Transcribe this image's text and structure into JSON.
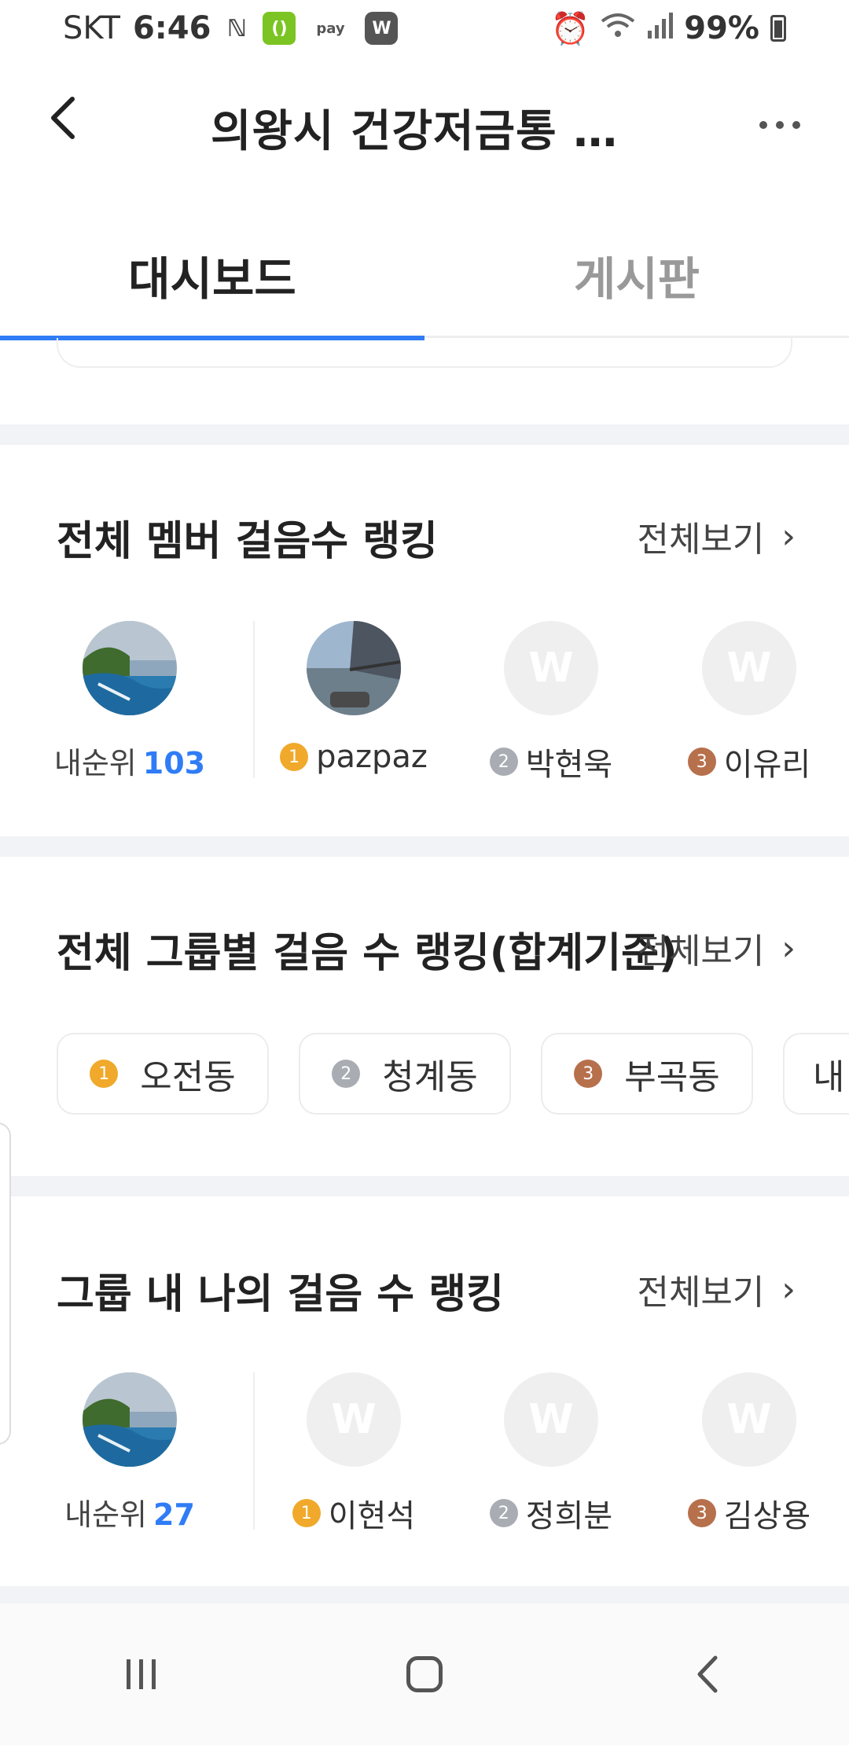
{
  "status_bar": {
    "carrier": "SKT",
    "time": "6:46",
    "app_icons": [
      "nfc-icon",
      "opinion-icon",
      "pay-icon",
      "w-app-icon"
    ],
    "pay_label": "pay",
    "battery": "99%"
  },
  "header": {
    "title": "의왕시 건강저금통 …",
    "back_icon": "back-arrow-icon",
    "more_icon": "more-icon"
  },
  "tabs": [
    {
      "label": "대시보드",
      "active": true
    },
    {
      "label": "게시판",
      "active": false
    }
  ],
  "member_ranking": {
    "title": "전체 멤버 걸음수 랭킹",
    "see_all": "전체보기",
    "my_rank_label": "내순위",
    "my_rank_value": "103",
    "members": [
      {
        "rank": "1",
        "name": "pazpaz"
      },
      {
        "rank": "2",
        "name": "박현욱"
      },
      {
        "rank": "3",
        "name": "이유리"
      }
    ]
  },
  "group_ranking": {
    "title": "전체 그룹별 걸음 수 랭킹(합계기준)",
    "see_all": "전체보기",
    "groups": [
      {
        "rank": "1",
        "name": "오전동"
      },
      {
        "rank": "2",
        "name": "청계동"
      },
      {
        "rank": "3",
        "name": "부곡동"
      },
      {
        "rank": "",
        "name": "내"
      }
    ]
  },
  "in_group_ranking": {
    "title": "그룹 내 나의 걸음 수 랭킹",
    "see_all": "전체보기",
    "my_rank_label": "내순위",
    "my_rank_value": "27",
    "members": [
      {
        "rank": "1",
        "name": "이현석"
      },
      {
        "rank": "2",
        "name": "정희분"
      },
      {
        "rank": "3",
        "name": "김상용"
      }
    ]
  },
  "placeholder_avatar_letter": "W",
  "colors": {
    "accent": "#2f7cf6",
    "gold": "#f0a92a",
    "silver": "#a9adb3",
    "bronze": "#b7704c"
  }
}
